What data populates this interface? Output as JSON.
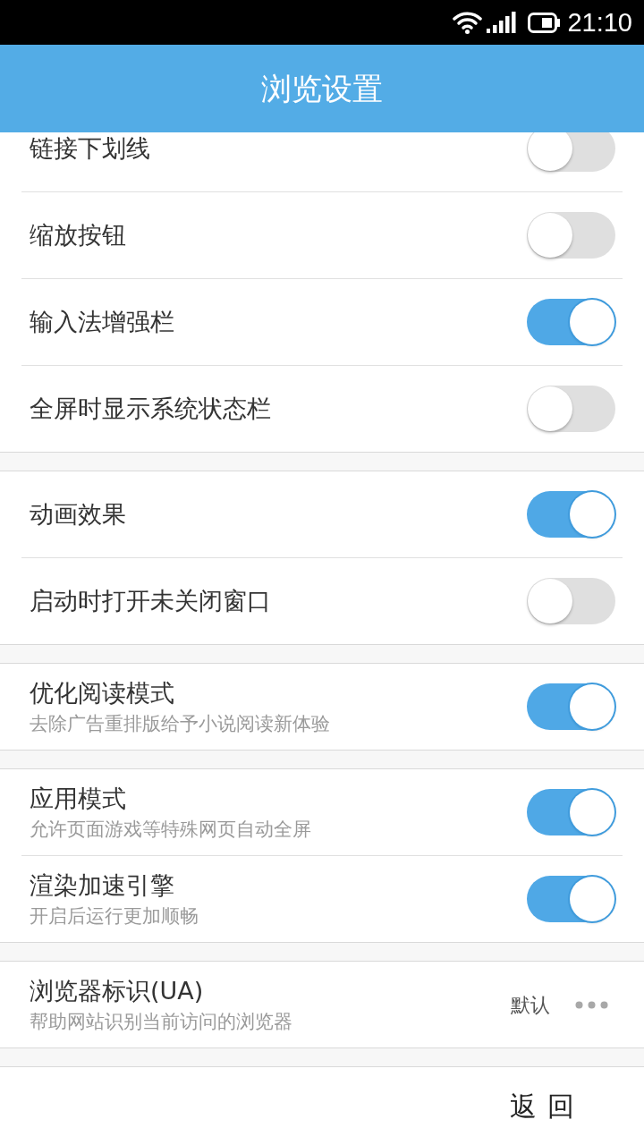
{
  "status_bar": {
    "time": "21:10"
  },
  "header": {
    "title": "浏览设置"
  },
  "groups": [
    {
      "items": [
        {
          "kind": "toggle",
          "title": "链接下划线",
          "on": false
        },
        {
          "kind": "toggle",
          "title": "缩放按钮",
          "on": false
        },
        {
          "kind": "toggle",
          "title": "输入法增强栏",
          "on": true
        },
        {
          "kind": "toggle",
          "title": "全屏时显示系统状态栏",
          "on": false
        }
      ]
    },
    {
      "items": [
        {
          "kind": "toggle",
          "title": "动画效果",
          "on": true
        },
        {
          "kind": "toggle",
          "title": "启动时打开未关闭窗口",
          "on": false
        }
      ]
    },
    {
      "items": [
        {
          "kind": "toggle",
          "title": "优化阅读模式",
          "subtitle": "去除广告重排版给予小说阅读新体验",
          "on": true
        }
      ]
    },
    {
      "items": [
        {
          "kind": "toggle",
          "title": "应用模式",
          "subtitle": "允许页面游戏等特殊网页自动全屏",
          "on": true
        },
        {
          "kind": "toggle",
          "title": "渲染加速引擎",
          "subtitle": "开启后运行更加顺畅",
          "on": true
        }
      ]
    },
    {
      "items": [
        {
          "kind": "choice",
          "title": "浏览器标识(UA)",
          "subtitle": "帮助网站识别当前访问的浏览器",
          "value": "默认"
        }
      ]
    }
  ],
  "bottom_bar": {
    "back_button": "返回"
  }
}
